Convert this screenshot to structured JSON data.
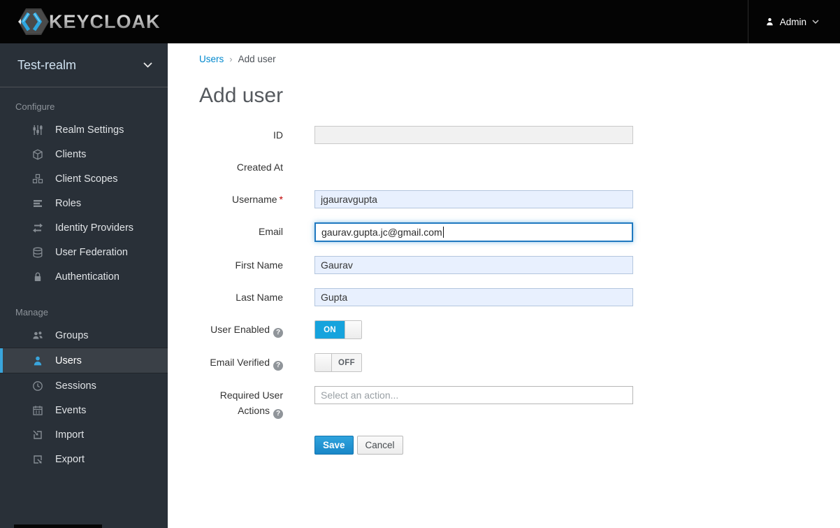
{
  "topbar": {
    "brand": "KEYCLOAK",
    "admin": {
      "label": "Admin",
      "icon": "user-icon",
      "caret": "chevron-down-icon"
    }
  },
  "sidebar": {
    "realm": {
      "name": "Test-realm",
      "caret": "chevron-down-icon"
    },
    "sections": [
      {
        "header": "Configure",
        "items": [
          {
            "label": "Realm Settings",
            "icon": "sliders-icon",
            "active": false
          },
          {
            "label": "Clients",
            "icon": "cube-icon",
            "active": false
          },
          {
            "label": "Client Scopes",
            "icon": "cubes-icon",
            "active": false
          },
          {
            "label": "Roles",
            "icon": "list-bars-icon",
            "active": false
          },
          {
            "label": "Identity Providers",
            "icon": "exchange-icon",
            "active": false
          },
          {
            "label": "User Federation",
            "icon": "database-icon",
            "active": false
          },
          {
            "label": "Authentication",
            "icon": "lock-icon",
            "active": false
          }
        ]
      },
      {
        "header": "Manage",
        "items": [
          {
            "label": "Groups",
            "icon": "group-icon",
            "active": false
          },
          {
            "label": "Users",
            "icon": "user-icon",
            "active": true
          },
          {
            "label": "Sessions",
            "icon": "clock-icon",
            "active": false
          },
          {
            "label": "Events",
            "icon": "calendar-icon",
            "active": false
          },
          {
            "label": "Import",
            "icon": "import-icon",
            "active": false
          },
          {
            "label": "Export",
            "icon": "export-icon",
            "active": false
          }
        ]
      }
    ]
  },
  "breadcrumb": {
    "parent": "Users",
    "separator": "›",
    "current": "Add user"
  },
  "page": {
    "title": "Add user"
  },
  "form": {
    "id": {
      "label": "ID",
      "value": "",
      "disabled": true
    },
    "created_at": {
      "label": "Created At"
    },
    "username": {
      "label": "Username",
      "required_marker": "*",
      "value": "jgauravgupta"
    },
    "email": {
      "label": "Email",
      "value": "gaurav.gupta.jc@gmail.com",
      "focused": true
    },
    "first_name": {
      "label": "First Name",
      "value": "Gaurav"
    },
    "last_name": {
      "label": "Last Name",
      "value": "Gupta"
    },
    "user_enabled": {
      "label": "User Enabled",
      "help": "?",
      "state": "ON"
    },
    "email_verified": {
      "label": "Email Verified",
      "help": "?",
      "state": "OFF"
    },
    "required_actions": {
      "label_line1": "Required User",
      "label_line2": "Actions",
      "help": "?",
      "placeholder": "Select an action..."
    }
  },
  "buttons": {
    "save": "Save",
    "cancel": "Cancel"
  },
  "colors": {
    "accent_blue": "#39a5dc",
    "link_blue": "#0088ce",
    "toggle_on": "#16a3dd",
    "focus_border": "#2079c0",
    "autofill_bg": "#e8f0fe",
    "required_red": "#c00000",
    "sidebar_bg": "#293038",
    "topbar_bg": "#040404"
  }
}
